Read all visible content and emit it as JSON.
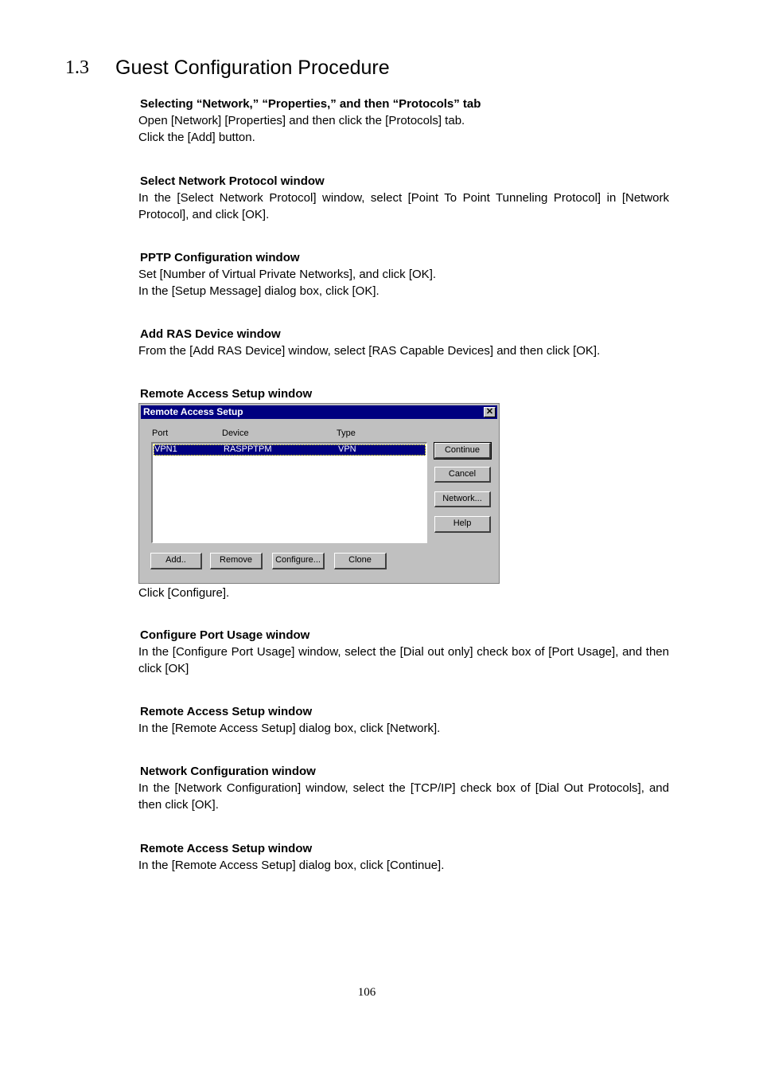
{
  "section": {
    "number": "1.3",
    "title": "Guest Configuration Procedure"
  },
  "blocks": [
    {
      "title": "Selecting “Network,” “Properties,” and then “Protocols” tab",
      "lines": [
        "Open [Network] [Properties] and then click the [Protocols] tab.",
        "Click the [Add] button."
      ]
    },
    {
      "title": "Select Network Protocol window",
      "lines": [
        "In the [Select Network Protocol] window, select [Point To Point Tunneling Protocol] in [Network Protocol], and click [OK]."
      ]
    },
    {
      "title": "PPTP Configuration window",
      "lines": [
        "Set [Number of Virtual Private Networks], and click [OK].",
        "In the [Setup Message] dialog box, click [OK]."
      ]
    },
    {
      "title": "Add RAS Device window",
      "lines": [
        "From the [Add RAS Device] window, select [RAS Capable Devices] and then click [OK]."
      ]
    },
    {
      "title": "Remote Access Setup window",
      "lines": [
        "Click [Configure]."
      ]
    },
    {
      "title": "Configure Port Usage window",
      "lines": [
        "In the [Configure Port Usage] window, select the [Dial out only] check box of [Port Usage], and then click [OK]"
      ]
    },
    {
      "title": "Remote Access Setup window",
      "lines": [
        "In the [Remote Access Setup] dialog box, click [Network]."
      ]
    },
    {
      "title": "Network Configuration window",
      "lines": [
        "In the [Network Configuration] window, select the [TCP/IP] check box of [Dial Out Protocols], and then click [OK]."
      ]
    },
    {
      "title": "Remote Access Setup window",
      "lines": [
        "In the [Remote Access Setup] dialog box, click [Continue]."
      ]
    }
  ],
  "dialog": {
    "title": "Remote Access Setup",
    "close_glyph": "✕",
    "columns": {
      "port": "Port",
      "device": "Device",
      "type": "Type"
    },
    "rows": [
      {
        "port": "VPN1",
        "device": "RASPPTPM",
        "type": "VPN",
        "selected": true
      }
    ],
    "side_buttons": {
      "continue": "Continue",
      "cancel": "Cancel",
      "network": "Network...",
      "help": "Help"
    },
    "bottom_buttons": {
      "add": "Add..",
      "remove": "Remove",
      "configure": "Configure...",
      "clone": "Clone"
    },
    "colors": {
      "titlebar": "#000080",
      "face": "#c0c0c0",
      "selection": "#000080"
    }
  },
  "page_number": "106"
}
